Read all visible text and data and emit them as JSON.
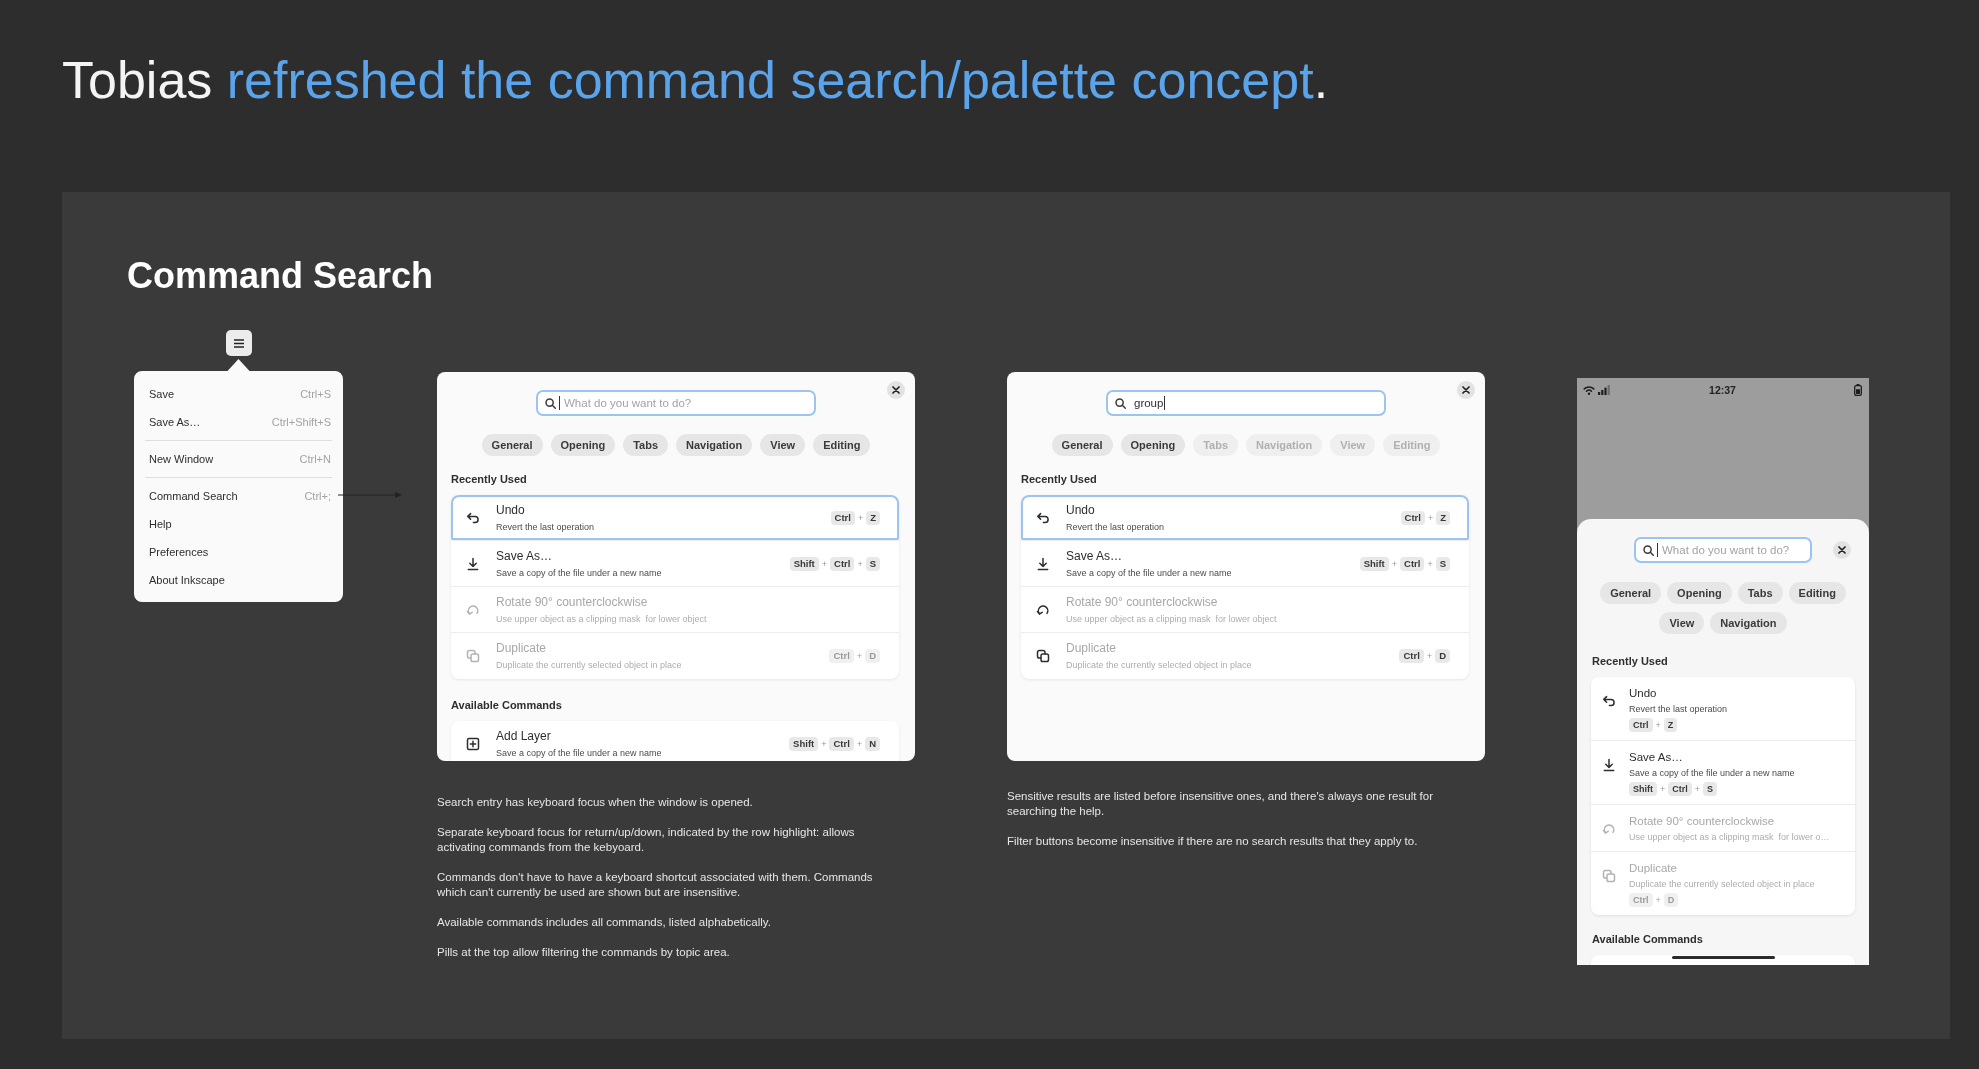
{
  "headline": {
    "author": "Tobias",
    "link": "refreshed the command search/palette concept",
    "end": "."
  },
  "board_title": "Command Search",
  "app_menu": {
    "sections": [
      {
        "items": [
          {
            "label": "Save",
            "shortcut": "Ctrl+S"
          },
          {
            "label": "Save As…",
            "shortcut": "Ctrl+Shift+S"
          }
        ]
      },
      {
        "items": [
          {
            "label": "New Window",
            "shortcut": "Ctrl+N"
          }
        ]
      },
      {
        "items": [
          {
            "label": "Command Search",
            "shortcut": "Ctrl+;"
          },
          {
            "label": "Help"
          },
          {
            "label": "Preferences"
          },
          {
            "label": "About Inkscape"
          }
        ]
      }
    ]
  },
  "mockups": [
    {
      "kind": "window",
      "search": {
        "placeholder": "What do you want to do?"
      },
      "filters": [
        {
          "label": "General",
          "disabled": false
        },
        {
          "label": "Opening",
          "disabled": false
        },
        {
          "label": "Tabs",
          "disabled": false
        },
        {
          "label": "Navigation",
          "disabled": false
        },
        {
          "label": "View",
          "disabled": false
        },
        {
          "label": "Editing",
          "disabled": false
        }
      ],
      "sections": [
        {
          "title": "Recently Used",
          "commands": [
            {
              "kind": "undo",
              "title": "Undo",
              "description": "Revert the last operation",
              "selected": true,
              "disabled": false,
              "icon_dimmed": false,
              "shortcut": {
                "dimmed": false,
                "parts": [
                  {
                    "kind": "key",
                    "text": "Ctrl"
                  },
                  {
                    "kind": "sep",
                    "text": "+"
                  },
                  {
                    "kind": "key",
                    "text": "Z"
                  }
                ]
              }
            },
            {
              "kind": "save",
              "title": "Save As…",
              "description": "Save a copy of the file under a new name",
              "selected": false,
              "disabled": false,
              "icon_dimmed": false,
              "shortcut": {
                "dimmed": false,
                "parts": [
                  {
                    "kind": "key",
                    "text": "Shift"
                  },
                  {
                    "kind": "sep",
                    "text": "+"
                  },
                  {
                    "kind": "key",
                    "text": "Ctrl"
                  },
                  {
                    "kind": "sep",
                    "text": "+"
                  },
                  {
                    "kind": "key",
                    "text": "S"
                  }
                ]
              }
            },
            {
              "kind": "rotate",
              "title": "Rotate 90° counterclockwise",
              "description": "Use upper object as a clipping mask  for lower object",
              "selected": false,
              "disabled": true,
              "icon_dimmed": true
            },
            {
              "kind": "duplicate",
              "title": "Duplicate",
              "description": "Duplicate the currently selected object in place",
              "selected": false,
              "disabled": true,
              "icon_dimmed": true,
              "shortcut": {
                "dimmed": true,
                "parts": [
                  {
                    "kind": "key",
                    "text": "Ctrl"
                  },
                  {
                    "kind": "sep",
                    "text": "+"
                  },
                  {
                    "kind": "key",
                    "text": "D"
                  }
                ]
              }
            }
          ]
        },
        {
          "title": "Available Commands",
          "commands": [
            {
              "kind": "add",
              "title": "Add Layer",
              "description": "Save a copy of the file under a new name",
              "selected": false,
              "disabled": false,
              "icon_dimmed": false,
              "shortcut": {
                "dimmed": false,
                "parts": [
                  {
                    "kind": "key",
                    "text": "Shift"
                  },
                  {
                    "kind": "sep",
                    "text": "+"
                  },
                  {
                    "kind": "key",
                    "text": "Ctrl"
                  },
                  {
                    "kind": "sep",
                    "text": "+"
                  },
                  {
                    "kind": "key",
                    "text": "N"
                  }
                ]
              }
            }
          ]
        }
      ],
      "notes": [
        "Search entry has keyboard focus when the window is opened.",
        "Separate keyboard focus for return/up/down, indicated by the row highlight: allows activating commands from the kebyoard.",
        "Commands don't have to have a keyboard shortcut associated with them. Commands which can't currently be used are shown but are insensitive.",
        "Available commands includes all commands, listed alphabetically.",
        "Pills at the top allow filtering the commands by topic area."
      ]
    },
    {
      "kind": "window",
      "search": {
        "value": "group"
      },
      "filters": [
        {
          "label": "General",
          "disabled": false
        },
        {
          "label": "Opening",
          "disabled": false
        },
        {
          "label": "Tabs",
          "disabled": true
        },
        {
          "label": "Navigation",
          "disabled": true
        },
        {
          "label": "View",
          "disabled": true
        },
        {
          "label": "Editing",
          "disabled": true
        }
      ],
      "sections": [
        {
          "title": "Recently Used",
          "commands": [
            {
              "kind": "undo",
              "title": "Undo",
              "description": "Revert the last operation",
              "selected": true,
              "disabled": false,
              "icon_dimmed": false,
              "shortcut": {
                "dimmed": false,
                "parts": [
                  {
                    "kind": "key",
                    "text": "Ctrl"
                  },
                  {
                    "kind": "sep",
                    "text": "+"
                  },
                  {
                    "kind": "key",
                    "text": "Z"
                  }
                ]
              }
            },
            {
              "kind": "save",
              "title": "Save As…",
              "description": "Save a copy of the file under a new name",
              "selected": false,
              "disabled": false,
              "icon_dimmed": false,
              "shortcut": {
                "dimmed": false,
                "parts": [
                  {
                    "kind": "key",
                    "text": "Shift"
                  },
                  {
                    "kind": "sep",
                    "text": "+"
                  },
                  {
                    "kind": "key",
                    "text": "Ctrl"
                  },
                  {
                    "kind": "sep",
                    "text": "+"
                  },
                  {
                    "kind": "key",
                    "text": "S"
                  }
                ]
              }
            },
            {
              "kind": "rotate",
              "title": "Rotate 90° counterclockwise",
              "description": "Use upper object as a clipping mask  for lower object",
              "selected": false,
              "disabled": true,
              "icon_dimmed": false
            },
            {
              "kind": "duplicate",
              "title": "Duplicate",
              "description": "Duplicate the currently selected object in place",
              "selected": false,
              "disabled": true,
              "icon_dimmed": false,
              "shortcut": {
                "dimmed": false,
                "parts": [
                  {
                    "kind": "key",
                    "text": "Ctrl"
                  },
                  {
                    "kind": "sep",
                    "text": "+"
                  },
                  {
                    "kind": "key",
                    "text": "D"
                  }
                ]
              }
            }
          ]
        }
      ],
      "notes": [
        "Sensitive results are listed before insensitive ones, and there's always one result for searching the help.",
        "Filter buttons become insensitive if there are no search results that they apply to."
      ]
    },
    {
      "kind": "phone",
      "status_bar": {
        "time": "12:37"
      },
      "search": {
        "placeholder": "What do you want to do?"
      },
      "filters": [
        {
          "label": "General",
          "disabled": false
        },
        {
          "label": "Opening",
          "disabled": false
        },
        {
          "label": "Tabs",
          "disabled": false
        },
        {
          "label": "Editing",
          "disabled": false
        },
        {
          "label": "View",
          "disabled": false
        },
        {
          "label": "Navigation",
          "disabled": false
        }
      ],
      "sections": [
        {
          "title": "Recently Used",
          "commands": [
            {
              "kind": "undo",
              "title": "Undo",
              "description": "Revert the last operation",
              "selected": false,
              "disabled": false,
              "icon_dimmed": false,
              "shortcut": {
                "dimmed": false,
                "parts": [
                  {
                    "kind": "key",
                    "text": "Ctrl"
                  },
                  {
                    "kind": "sep",
                    "text": "+"
                  },
                  {
                    "kind": "key",
                    "text": "Z"
                  }
                ]
              }
            },
            {
              "kind": "save",
              "title": "Save As…",
              "description": "Save a copy of the file under a new name",
              "selected": false,
              "disabled": false,
              "icon_dimmed": false,
              "shortcut": {
                "dimmed": false,
                "parts": [
                  {
                    "kind": "key",
                    "text": "Shift"
                  },
                  {
                    "kind": "sep",
                    "text": "+"
                  },
                  {
                    "kind": "key",
                    "text": "Ctrl"
                  },
                  {
                    "kind": "sep",
                    "text": "+"
                  },
                  {
                    "kind": "key",
                    "text": "S"
                  }
                ]
              }
            },
            {
              "kind": "rotate",
              "title": "Rotate 90° counterclockwise",
              "description": "Use upper object as a clipping mask  for lower o…",
              "selected": false,
              "disabled": true,
              "icon_dimmed": true
            },
            {
              "kind": "duplicate",
              "title": "Duplicate",
              "description": "Duplicate the currently selected object in place",
              "selected": false,
              "disabled": true,
              "icon_dimmed": true,
              "shortcut": {
                "dimmed": true,
                "parts": [
                  {
                    "kind": "key",
                    "text": "Ctrl"
                  },
                  {
                    "kind": "sep",
                    "text": "+"
                  },
                  {
                    "kind": "key",
                    "text": "D"
                  }
                ]
              }
            }
          ]
        },
        {
          "title": "Available Commands"
        }
      ]
    }
  ]
}
